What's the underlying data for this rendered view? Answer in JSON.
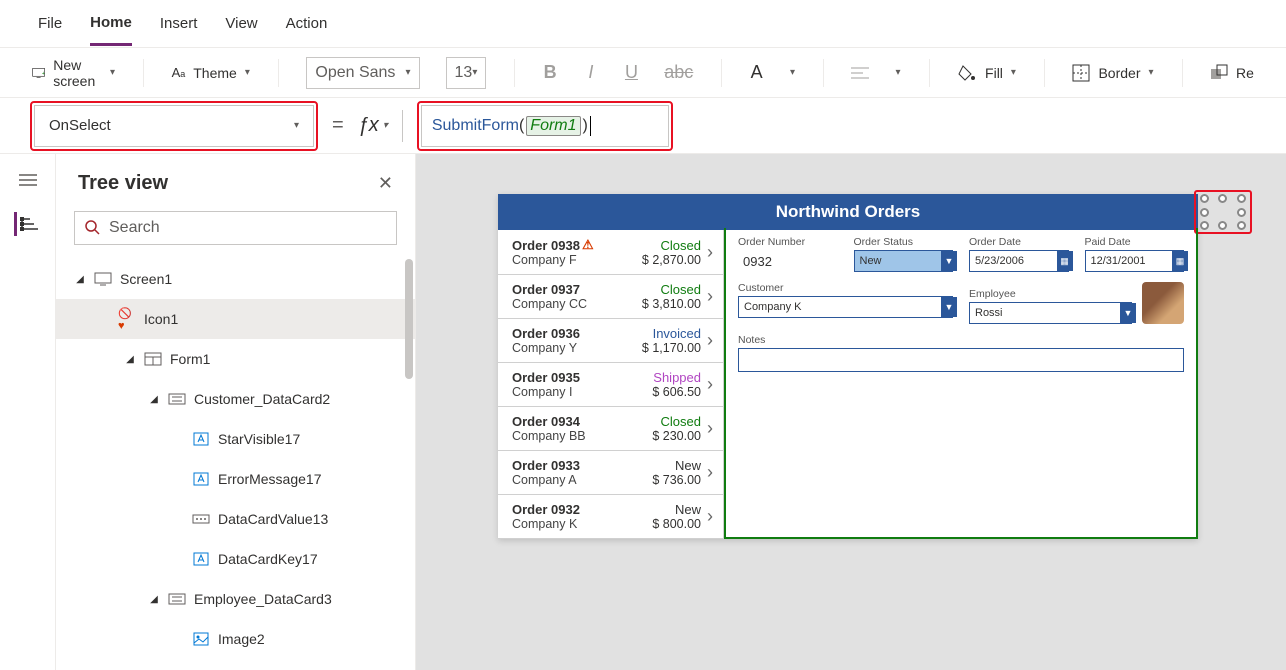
{
  "menubar": {
    "tabs": [
      "File",
      "Home",
      "Insert",
      "View",
      "Action"
    ],
    "active": "Home"
  },
  "ribbon": {
    "new_screen": "New screen",
    "theme": "Theme",
    "font": "Open Sans",
    "size": "13",
    "fill": "Fill",
    "border": "Border",
    "reorder": "Re"
  },
  "formula": {
    "property": "OnSelect",
    "fn": "SubmitForm",
    "arg": "Form1"
  },
  "tree": {
    "title": "Tree view",
    "search_placeholder": "Search",
    "items": [
      {
        "label": "Screen1",
        "indent": 1,
        "icon": "screen",
        "expanded": true
      },
      {
        "label": "Icon1",
        "indent": 2,
        "icon": "icon",
        "selected": true
      },
      {
        "label": "Form1",
        "indent": 3,
        "icon": "form",
        "expanded": true
      },
      {
        "label": "Customer_DataCard2",
        "indent": 4,
        "icon": "card",
        "expanded": true
      },
      {
        "label": "StarVisible17",
        "indent": 5,
        "icon": "label"
      },
      {
        "label": "ErrorMessage17",
        "indent": 5,
        "icon": "label"
      },
      {
        "label": "DataCardValue13",
        "indent": 5,
        "icon": "input"
      },
      {
        "label": "DataCardKey17",
        "indent": 5,
        "icon": "label"
      },
      {
        "label": "Employee_DataCard3",
        "indent": 4,
        "icon": "card",
        "expanded": true
      },
      {
        "label": "Image2",
        "indent": 5,
        "icon": "image"
      }
    ]
  },
  "app": {
    "title": "Northwind Orders",
    "list": [
      {
        "order": "Order 0938",
        "company": "Company F",
        "status": "Closed",
        "amount": "$ 2,870.00",
        "warn": true
      },
      {
        "order": "Order 0937",
        "company": "Company CC",
        "status": "Closed",
        "amount": "$ 3,810.00"
      },
      {
        "order": "Order 0936",
        "company": "Company Y",
        "status": "Invoiced",
        "amount": "$ 1,170.00"
      },
      {
        "order": "Order 0935",
        "company": "Company I",
        "status": "Shipped",
        "amount": "$ 606.50"
      },
      {
        "order": "Order 0934",
        "company": "Company BB",
        "status": "Closed",
        "amount": "$ 230.00"
      },
      {
        "order": "Order 0933",
        "company": "Company A",
        "status": "New",
        "amount": "$ 736.00"
      },
      {
        "order": "Order 0932",
        "company": "Company K",
        "status": "New",
        "amount": "$ 800.00"
      }
    ],
    "form": {
      "order_number_label": "Order Number",
      "order_number": "0932",
      "order_status_label": "Order Status",
      "order_status": "New",
      "order_date_label": "Order Date",
      "order_date": "5/23/2006",
      "paid_date_label": "Paid Date",
      "paid_date": "12/31/2001",
      "customer_label": "Customer",
      "customer": "Company K",
      "employee_label": "Employee",
      "employee": "Rossi",
      "notes_label": "Notes"
    }
  }
}
